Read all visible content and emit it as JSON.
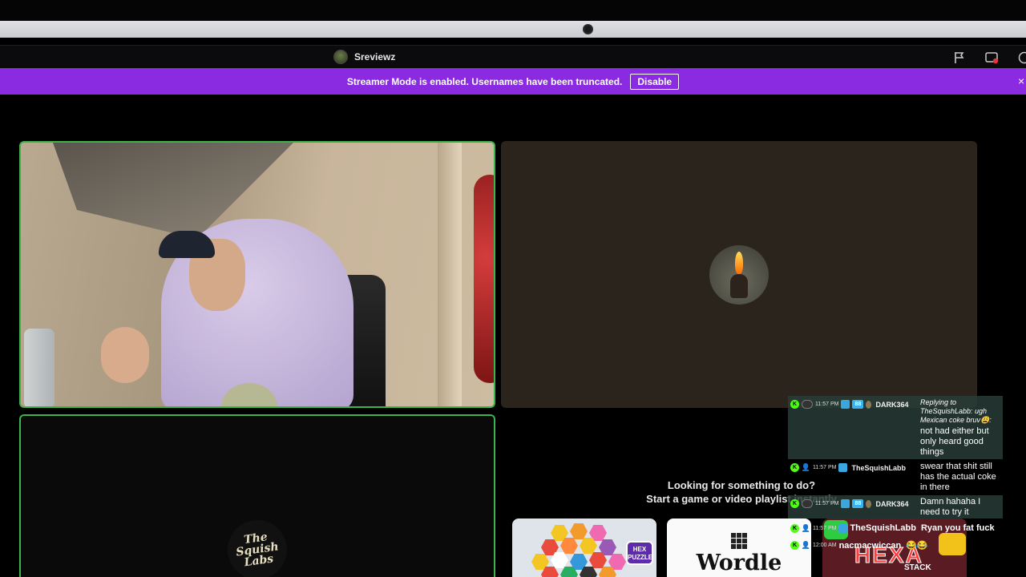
{
  "header": {
    "channel_name": "Sreviewz"
  },
  "banner": {
    "text": "Streamer Mode is enabled. Usernames have been truncated.",
    "button": "Disable",
    "close": "×"
  },
  "tiles": {
    "bottom_logo_lines": [
      "The",
      "Squish",
      "Labs"
    ]
  },
  "suggestions": {
    "line1": "Looking for something to do?",
    "line2": "Start a game or video playlist instantly",
    "cards": [
      {
        "name": "hex-puzzle",
        "badge": "HEX PUZZLE"
      },
      {
        "name": "wordle",
        "title": "Wordle"
      },
      {
        "name": "hexa-stack",
        "title": "HEXA",
        "subtitle": "STACK"
      }
    ]
  },
  "chat": {
    "messages": [
      {
        "time": "11:57 PM",
        "user": "DARK364",
        "reply": "Replying to TheSquishLabb: ugh Mexican coke bruv😩:",
        "text": "not had either but only heard good things"
      },
      {
        "time": "11:57 PM",
        "user": "TheSquishLabb",
        "text": "swear that shit still has the actual coke in there"
      },
      {
        "time": "11:57 PM",
        "user": "DARK364",
        "text": "Damn hahaha I need to try it"
      },
      {
        "time": "11:57 PM",
        "user": "TheSquishLabb",
        "text": "Ryan you fat fuck"
      },
      {
        "time": "12:00 AM",
        "user": "nacmacwiccan",
        "text": "😂😂"
      }
    ]
  },
  "colors": {
    "banner": "#8a2be2",
    "speaking_border": "#3bb54a",
    "kick_green": "#53fc18"
  }
}
